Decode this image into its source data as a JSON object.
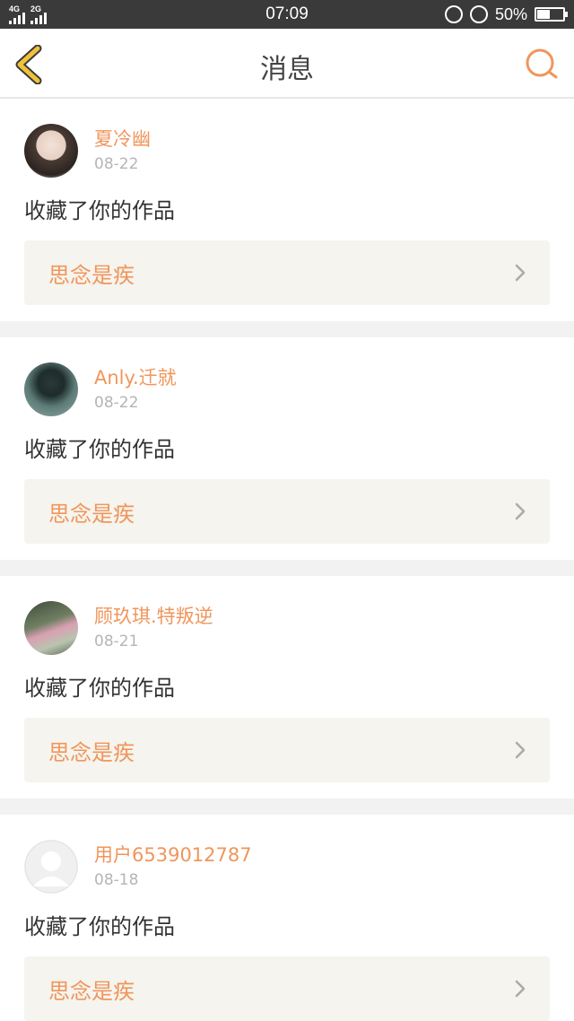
{
  "status_bar": {
    "net1": "4G",
    "net2": "2G",
    "time": "07:09",
    "battery_text": "50%",
    "battery_level": 0.5
  },
  "header": {
    "title": "消息",
    "back_icon": "chevron-left-icon",
    "search_icon": "search-icon",
    "accent": "#f0c23a",
    "search_color": "#f0965c"
  },
  "colors": {
    "username": "#f0965c",
    "work_bg": "#f5f4ee",
    "date": "#b5b5b5"
  },
  "messages": [
    {
      "username": "夏冷幽",
      "date": "08-22",
      "action": "收藏了你的作品",
      "work_title": "思念是疾"
    },
    {
      "username": "Anly.迁就",
      "date": "08-22",
      "action": "收藏了你的作品",
      "work_title": "思念是疾"
    },
    {
      "username": "顾玖琪.特叛逆",
      "date": "08-21",
      "action": "收藏了你的作品",
      "work_title": "思念是疾"
    },
    {
      "username": "用户6539012787",
      "date": "08-18",
      "action": "收藏了你的作品",
      "work_title": "思念是疾"
    }
  ]
}
